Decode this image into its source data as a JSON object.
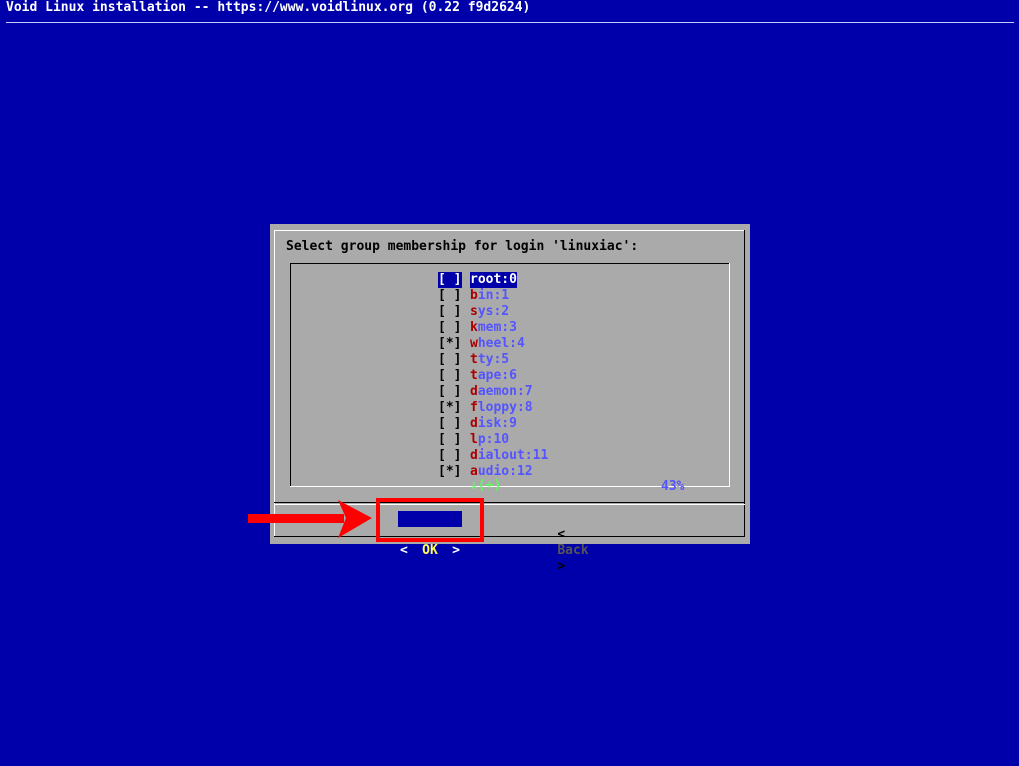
{
  "window": {
    "title": "Void Linux installation -- https://www.voidlinux.org (0.22 f9d2624)"
  },
  "dialog": {
    "prompt": "Select group membership for login 'linuxiac':",
    "items": [
      {
        "check": "[ ]",
        "hot": "r",
        "rest": "oot:0",
        "selected": true
      },
      {
        "check": "[ ]",
        "hot": "b",
        "rest": "in:1"
      },
      {
        "check": "[ ]",
        "hot": "s",
        "rest": "ys:2"
      },
      {
        "check": "[ ]",
        "hot": "k",
        "rest": "mem:3"
      },
      {
        "check": "[*]",
        "hot": "w",
        "rest": "heel:4"
      },
      {
        "check": "[ ]",
        "hot": "t",
        "rest": "ty:5"
      },
      {
        "check": "[ ]",
        "hot": "t",
        "rest": "ape:6"
      },
      {
        "check": "[ ]",
        "hot": "d",
        "rest": "aemon:7"
      },
      {
        "check": "[*]",
        "hot": "f",
        "rest": "loppy:8"
      },
      {
        "check": "[ ]",
        "hot": "d",
        "rest": "isk:9"
      },
      {
        "check": "[ ]",
        "hot": "l",
        "rest": "p:10"
      },
      {
        "check": "[ ]",
        "hot": "d",
        "rest": "ialout:11"
      },
      {
        "check": "[*]",
        "hot": "a",
        "rest": "udio:12"
      }
    ],
    "more_indicator": "↓(+)",
    "scroll_percent": "43%",
    "ok_button": {
      "left": "<",
      "label": "OK",
      "right": ">"
    },
    "back_button": {
      "left": "<",
      "label": "Back",
      "right": ">"
    }
  },
  "colors": {
    "background": "#0000aa",
    "dialog": "#aaaaaa",
    "hotkey": "#aa0000",
    "item_text": "#5555ff",
    "annotation": "#ff0000"
  }
}
